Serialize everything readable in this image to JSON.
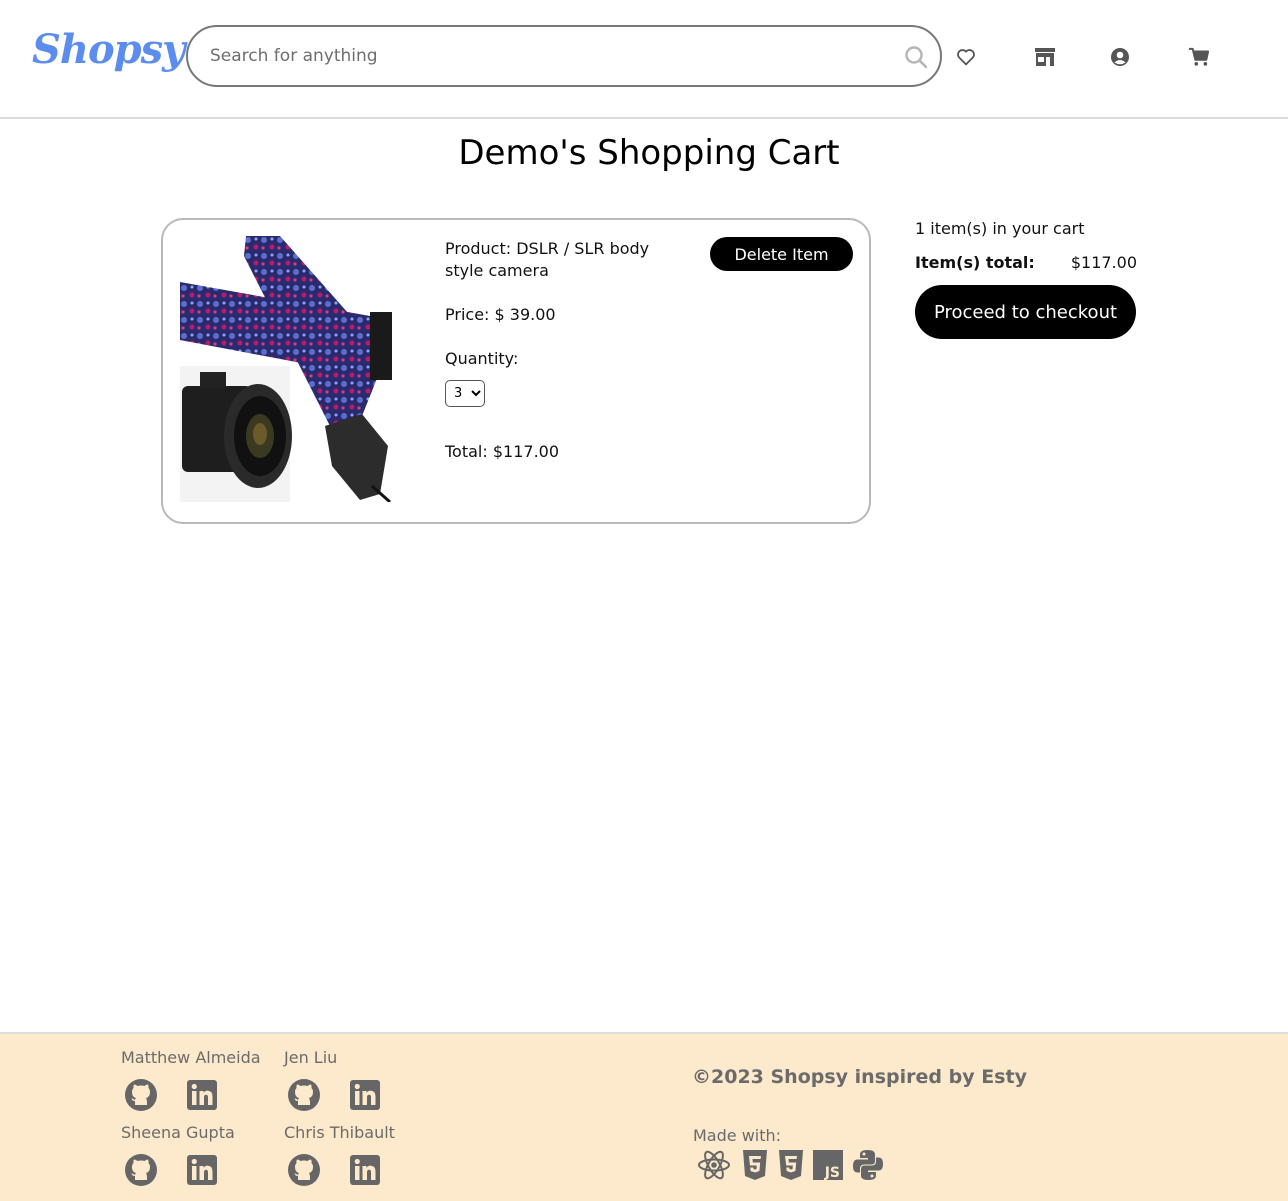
{
  "header": {
    "logo": "Shopsy",
    "search_placeholder": "Search for anything",
    "icons": [
      "heart-icon",
      "store-icon",
      "user-icon",
      "cart-icon"
    ]
  },
  "page_title": "Demo's Shopping Cart",
  "cart_item": {
    "product": "Product: DSLR / SLR body style camera",
    "price": "Price: $ 39.00",
    "quantity_label": "Quantity:",
    "quantity_value": "3",
    "total": "Total: $117.00",
    "delete_label": "Delete Item"
  },
  "summary": {
    "count_text": "1 item(s) in your cart",
    "total_label": "Item(s) total:",
    "total_value": "$117.00",
    "checkout_label": "Proceed to checkout"
  },
  "footer": {
    "members": [
      {
        "name": "Matthew Almeida"
      },
      {
        "name": "Jen Liu"
      },
      {
        "name": "Sheena Gupta"
      },
      {
        "name": "Chris Thibault"
      }
    ],
    "copyright": "©2023 Shopsy inspired by Esty",
    "made_with": "Made with:",
    "tech_icons": [
      "react-icon",
      "html5-icon",
      "css3-icon",
      "js-icon",
      "python-icon"
    ]
  },
  "colors": {
    "brand": "#5b8def",
    "footer_bg": "#fde9cb",
    "button": "#000000",
    "icon_gray": "#666666"
  }
}
